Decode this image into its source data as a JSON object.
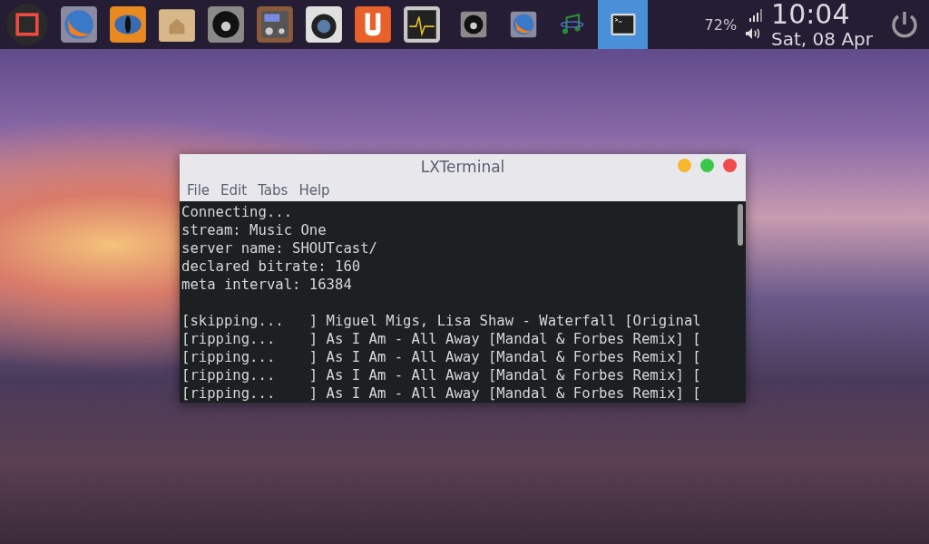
{
  "panel": {
    "launchers": [
      {
        "kind": "stop"
      },
      {
        "kind": "globe"
      },
      {
        "kind": "eye"
      },
      {
        "kind": "folder"
      },
      {
        "kind": "disc"
      },
      {
        "kind": "radio"
      },
      {
        "kind": "camera"
      },
      {
        "kind": "u-app"
      },
      {
        "kind": "monitor"
      }
    ],
    "windows": [
      {
        "kind": "disc",
        "selected": false
      },
      {
        "kind": "globe",
        "selected": false
      },
      {
        "kind": "music",
        "selected": false
      },
      {
        "kind": "terminal",
        "selected": true
      }
    ],
    "battery": "72%",
    "time": "10:04",
    "date": "Sat, 08 Apr"
  },
  "window": {
    "title": "LXTerminal",
    "menu": [
      "File",
      "Edit",
      "Tabs",
      "Help"
    ],
    "header": [
      "Connecting...",
      "stream: Music One",
      "server name: SHOUTcast/",
      "declared bitrate: 160",
      "meta interval: 16384"
    ],
    "log": [
      "[skipping...   ] Miguel Migs, Lisa Shaw - Waterfall [Original",
      "[ripping...    ] As I Am - All Away [Mandal & Forbes Remix] [",
      "[ripping...    ] As I Am - All Away [Mandal & Forbes Remix] [",
      "[ripping...    ] As I Am - All Away [Mandal & Forbes Remix] [",
      "[ripping...    ] As I Am - All Away [Mandal & Forbes Remix] ["
    ]
  }
}
